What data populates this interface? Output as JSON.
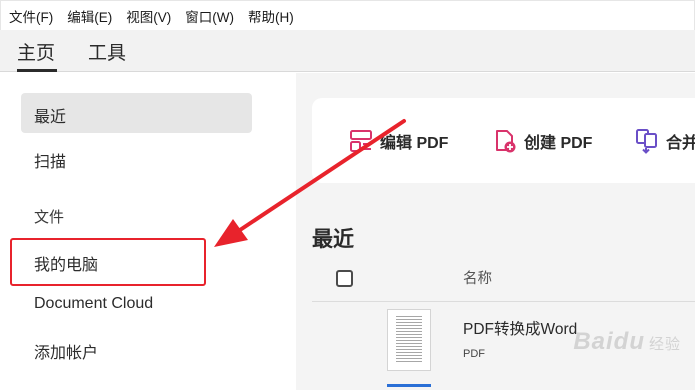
{
  "menu": {
    "items": [
      "文件(F)",
      "编辑(E)",
      "视图(V)",
      "窗口(W)",
      "帮助(H)"
    ]
  },
  "tabs": {
    "home": "主页",
    "tools": "工具"
  },
  "sidebar": {
    "recent": "最近",
    "scan": "扫描",
    "files_heading": "文件",
    "my_computer": "我的电脑",
    "document_cloud": "Document Cloud",
    "add_account": "添加帐户"
  },
  "tools": {
    "edit_pdf": "编辑 PDF",
    "create_pdf": "创建 PDF",
    "combine": "合并"
  },
  "recent": {
    "title": "最近",
    "col_name": "名称",
    "files": [
      {
        "name": "PDF转换成Word",
        "type": "PDF"
      }
    ]
  },
  "watermark": {
    "brand": "Baidu",
    "sub": "经验"
  },
  "colors": {
    "annotation_red": "#e8232c",
    "tool_icon_pink": "#d9336b",
    "tool_icon_purple": "#6a4fc7",
    "selection_blue": "#2a6fd6"
  }
}
